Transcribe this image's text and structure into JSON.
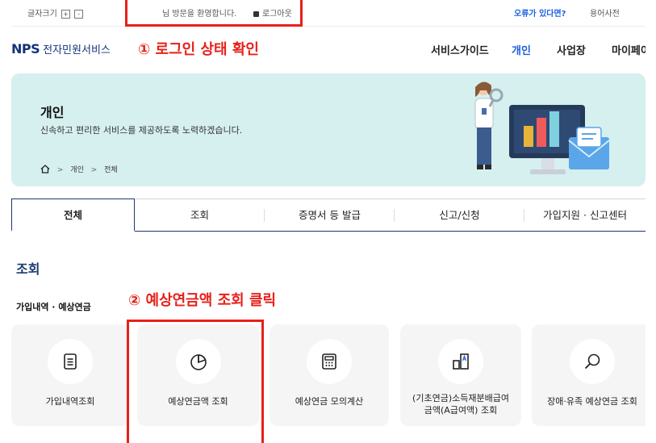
{
  "utility": {
    "font_size_label": "글자크기",
    "font_plus": "+",
    "font_minus": "-",
    "welcome": "님 방문을 환영합니다.",
    "logout": "로그아웃",
    "error_report": "오류가 있다면?",
    "dictionary": "용어사전"
  },
  "header": {
    "logo_text": "NPS",
    "logo_ko": "전자민원서비스",
    "nav": [
      "서비스가이드",
      "개인",
      "사업장",
      "마이페이"
    ],
    "active_nav": "개인"
  },
  "annotations": {
    "step1": "① 로그인 상태 확인",
    "step2": "② 예상연금액 조회 클릭"
  },
  "banner": {
    "title": "개인",
    "description": "신속하고 편리한 서비스를 제공하도록 노력하겠습니다.",
    "breadcrumb": [
      "개인",
      "전체"
    ]
  },
  "tabs": [
    "전체",
    "조회",
    "증명서 등 발급",
    "신고/신청",
    "가입지원 · 신고센터"
  ],
  "section": {
    "title": "조회",
    "subtitle": "가입내역 · 예상연금",
    "cards": [
      {
        "label": "가입내역조회",
        "icon": "document-list-icon"
      },
      {
        "label": "예상연금액 조회",
        "icon": "pie-chart-icon"
      },
      {
        "label": "예상연금 모의계산",
        "icon": "calculator-icon"
      },
      {
        "label_line1": "(기초연금)소득재분배급여",
        "label_line2": "금액(A급여액) 조회",
        "icon": "chart-a-icon"
      },
      {
        "label": "장애·유족 예상연금 조회",
        "icon": "magnifier-icon"
      }
    ]
  },
  "colors": {
    "accent": "#1d5fe0",
    "navy": "#1a3a6e",
    "annotation_red": "#e8201a",
    "banner_bg": "#d6efef"
  }
}
